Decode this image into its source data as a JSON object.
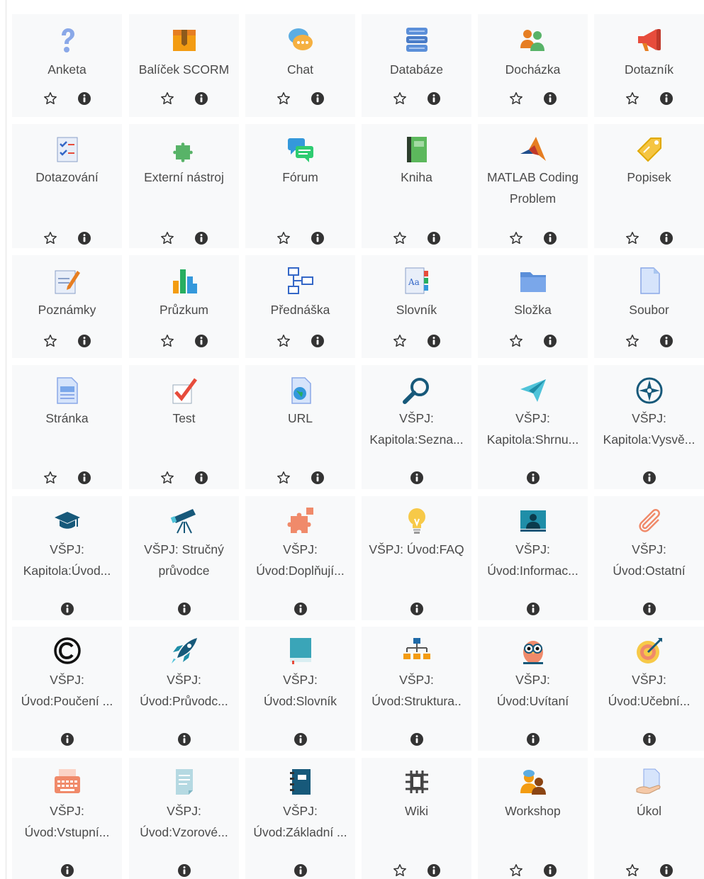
{
  "colors": {
    "tile_background": "#f8f9fa",
    "text": "#4a4a4a",
    "action_icon": "#333333"
  },
  "tiles": [
    {
      "label_lines": [
        "Anketa"
      ],
      "icon": "question-mark-icon",
      "favourite": true
    },
    {
      "label_lines": [
        "Balíček SCORM"
      ],
      "icon": "package-icon",
      "favourite": true
    },
    {
      "label_lines": [
        "Chat"
      ],
      "icon": "chat-bubbles-icon",
      "favourite": true
    },
    {
      "label_lines": [
        "Databáze"
      ],
      "icon": "database-icon",
      "favourite": true
    },
    {
      "label_lines": [
        "Docházka"
      ],
      "icon": "attendance-people-icon",
      "favourite": true
    },
    {
      "label_lines": [
        "Dotazník"
      ],
      "icon": "megaphone-icon",
      "favourite": true
    },
    {
      "label_lines": [
        "Dotazování"
      ],
      "icon": "checklist-icon",
      "favourite": true
    },
    {
      "label_lines": [
        "Externí nástroj"
      ],
      "icon": "puzzle-icon",
      "favourite": true
    },
    {
      "label_lines": [
        "Fórum"
      ],
      "icon": "forum-bubbles-icon",
      "favourite": true
    },
    {
      "label_lines": [
        "Kniha"
      ],
      "icon": "book-icon",
      "favourite": true
    },
    {
      "label_lines": [
        "MATLAB Coding",
        "Problem"
      ],
      "icon": "matlab-logo-icon",
      "favourite": true
    },
    {
      "label_lines": [
        "Popisek"
      ],
      "icon": "tag-icon",
      "favourite": true
    },
    {
      "label_lines": [
        "Poznámky"
      ],
      "icon": "notes-pencil-icon",
      "favourite": true
    },
    {
      "label_lines": [
        "Průzkum"
      ],
      "icon": "bar-chart-icon",
      "favourite": true
    },
    {
      "label_lines": [
        "Přednáška"
      ],
      "icon": "flowchart-icon",
      "favourite": true
    },
    {
      "label_lines": [
        "Slovník"
      ],
      "icon": "dictionary-icon",
      "favourite": true
    },
    {
      "label_lines": [
        "Složka"
      ],
      "icon": "folder-icon",
      "favourite": true
    },
    {
      "label_lines": [
        "Soubor"
      ],
      "icon": "file-icon",
      "favourite": true
    },
    {
      "label_lines": [
        "Stránka"
      ],
      "icon": "page-icon",
      "favourite": true
    },
    {
      "label_lines": [
        "Test"
      ],
      "icon": "checkmark-icon",
      "favourite": true
    },
    {
      "label_lines": [
        "URL"
      ],
      "icon": "globe-document-icon",
      "favourite": true
    },
    {
      "label_lines": [
        "VŠPJ:",
        "Kapitola:Sezna..."
      ],
      "icon": "magnifier-icon",
      "favourite": false
    },
    {
      "label_lines": [
        "VŠPJ:",
        "Kapitola:Shrnu..."
      ],
      "icon": "paper-plane-icon",
      "favourite": false
    },
    {
      "label_lines": [
        "VŠPJ:",
        "Kapitola:Vysvě..."
      ],
      "icon": "compass-icon",
      "favourite": false
    },
    {
      "label_lines": [
        "VŠPJ:",
        "Kapitola:Úvod..."
      ],
      "icon": "graduation-cap-icon",
      "favourite": false
    },
    {
      "label_lines": [
        "VŠPJ: Stručný",
        "průvodce"
      ],
      "icon": "telescope-icon",
      "favourite": false
    },
    {
      "label_lines": [
        "VŠPJ:",
        "Úvod:Doplňují..."
      ],
      "icon": "puzzle-orange-icon",
      "favourite": false
    },
    {
      "label_lines": [
        "VŠPJ: Úvod:FAQ"
      ],
      "icon": "lightbulb-icon",
      "favourite": false
    },
    {
      "label_lines": [
        "VŠPJ:",
        "Úvod:Informac..."
      ],
      "icon": "presenter-icon",
      "favourite": false
    },
    {
      "label_lines": [
        "VŠPJ:",
        "Úvod:Ostatní"
      ],
      "icon": "paperclip-icon",
      "favourite": false
    },
    {
      "label_lines": [
        "VŠPJ:",
        "Úvod:Poučení ..."
      ],
      "icon": "copyright-icon",
      "favourite": false
    },
    {
      "label_lines": [
        "VŠPJ:",
        "Úvod:Průvodc..."
      ],
      "icon": "rocket-icon",
      "favourite": false
    },
    {
      "label_lines": [
        "VŠPJ:",
        "Úvod:Slovník"
      ],
      "icon": "teal-book-icon",
      "favourite": false
    },
    {
      "label_lines": [
        "VŠPJ:",
        "Úvod:Struktura.."
      ],
      "icon": "hierarchy-icon",
      "favourite": false
    },
    {
      "label_lines": [
        "VŠPJ:",
        "Úvod:Uvítaní"
      ],
      "icon": "owl-icon",
      "favourite": false
    },
    {
      "label_lines": [
        "VŠPJ:",
        "Úvod:Učební..."
      ],
      "icon": "target-icon",
      "favourite": false
    },
    {
      "label_lines": [
        "VŠPJ:",
        "Úvod:Vstupní..."
      ],
      "icon": "typewriter-icon",
      "favourite": false
    },
    {
      "label_lines": [
        "VŠPJ:",
        "Úvod:Vzorové..."
      ],
      "icon": "sample-document-icon",
      "favourite": false
    },
    {
      "label_lines": [
        "VŠPJ:",
        "Úvod:Základní ..."
      ],
      "icon": "notebook-icon",
      "favourite": false
    },
    {
      "label_lines": [
        "Wiki"
      ],
      "icon": "wiki-icon",
      "favourite": true
    },
    {
      "label_lines": [
        "Workshop"
      ],
      "icon": "workshop-people-icon",
      "favourite": true
    },
    {
      "label_lines": [
        "Úkol"
      ],
      "icon": "assignment-hand-icon",
      "favourite": true
    }
  ]
}
